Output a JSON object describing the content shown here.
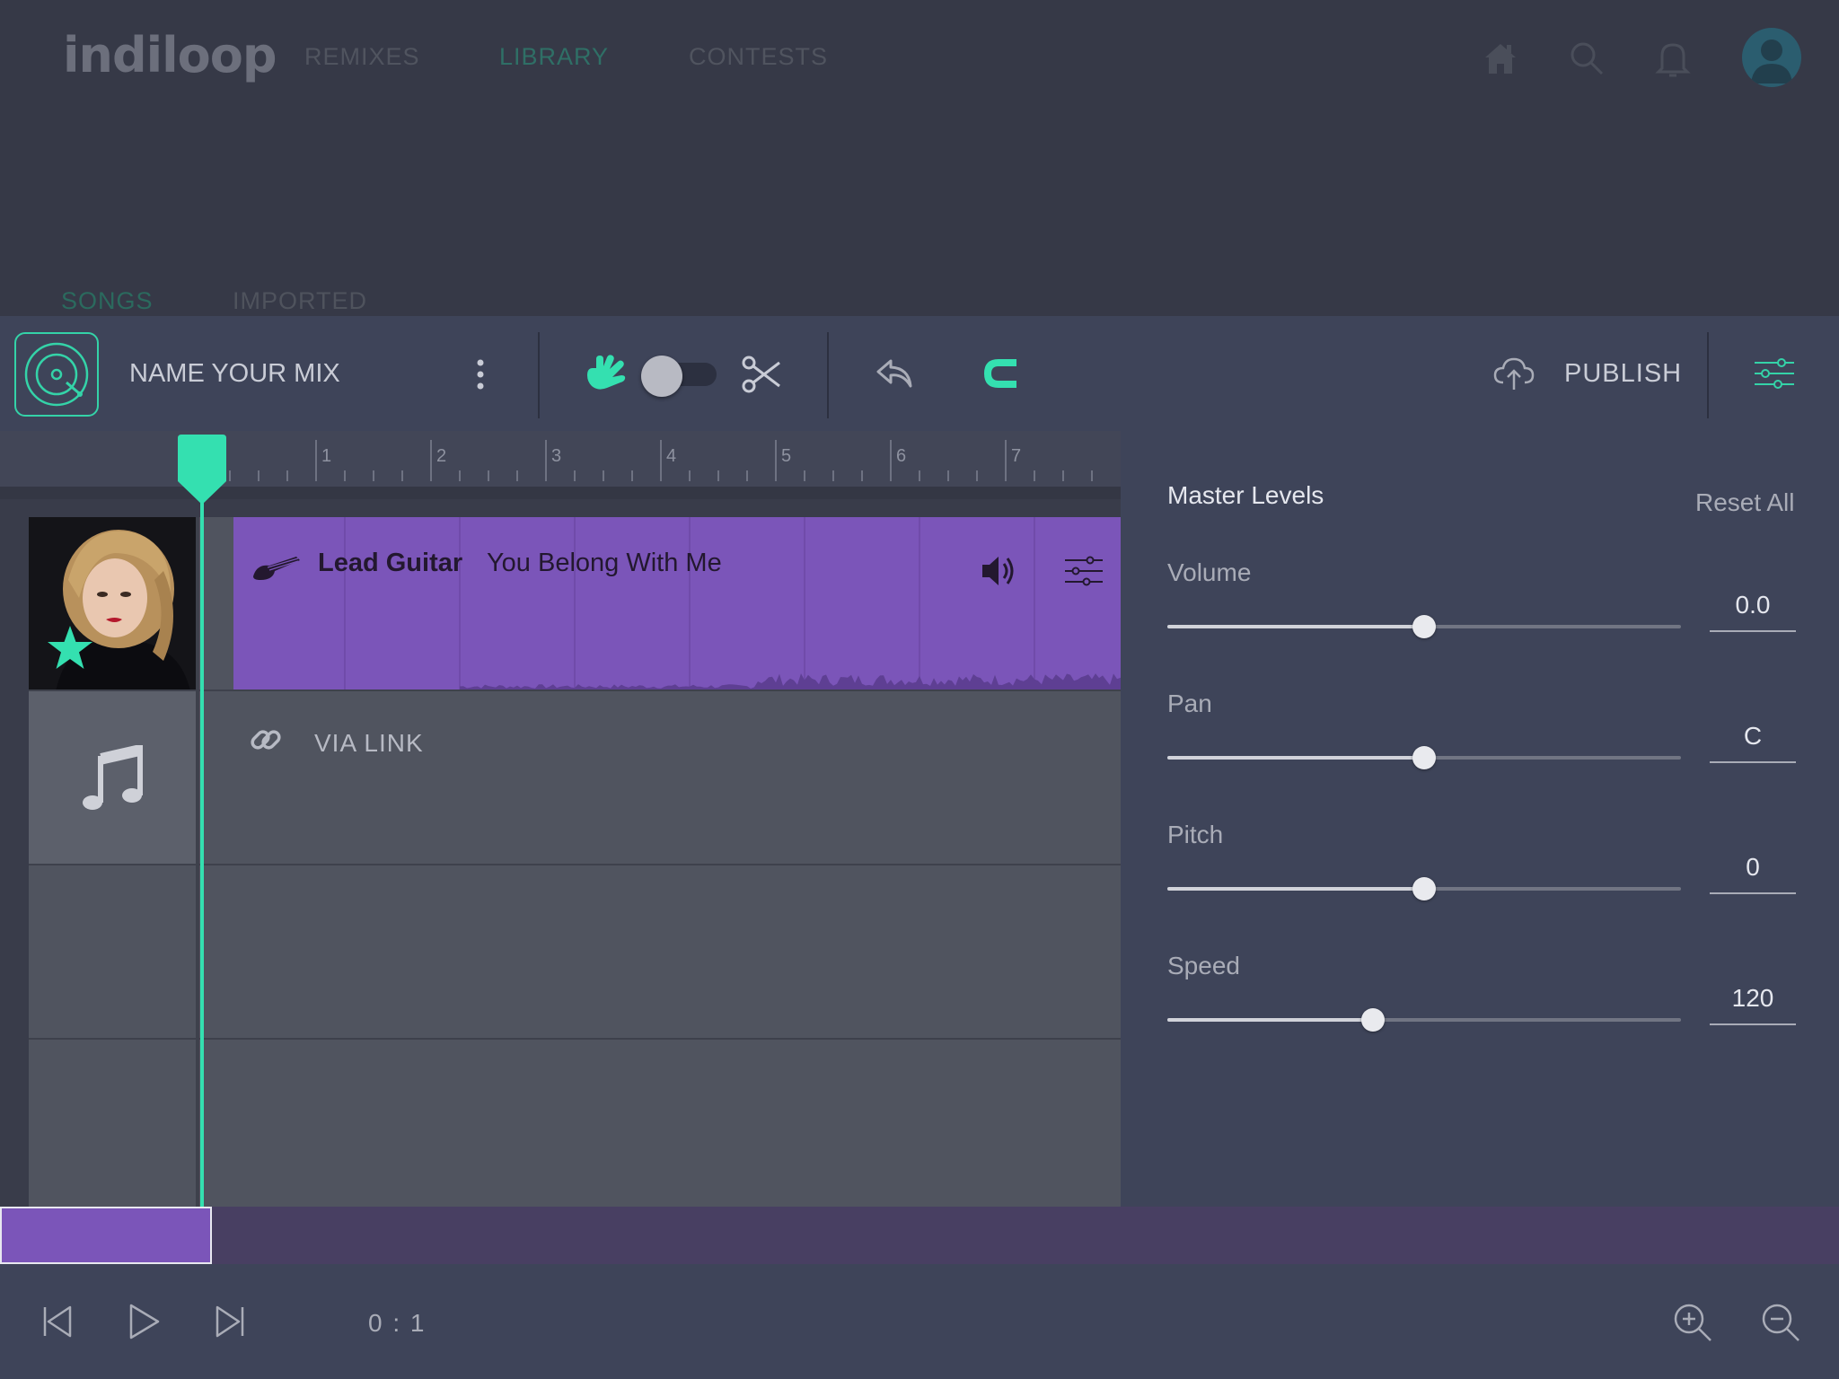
{
  "app": {
    "logo": "indiloop"
  },
  "nav": {
    "links": [
      "REMIXES",
      "LIBRARY",
      "CONTESTS"
    ],
    "active": "LIBRARY"
  },
  "subtabs": {
    "items": [
      "SONGS",
      "IMPORTED"
    ],
    "active": "SONGS"
  },
  "toolbar": {
    "mix_name": "NAME YOUR MIX",
    "publish_label": "PUBLISH",
    "mode_toggle": "off"
  },
  "ruler": {
    "marks": [
      "1",
      "2",
      "3",
      "4",
      "5",
      "6",
      "7"
    ]
  },
  "tracks": [
    {
      "instrument": "Lead Guitar",
      "song": "You Belong With Me"
    },
    {
      "label": "VIA LINK"
    }
  ],
  "master_levels": {
    "title": "Master Levels",
    "reset_label": "Reset All",
    "levels": [
      {
        "name": "Volume",
        "value": "0.0",
        "position": 0.5
      },
      {
        "name": "Pan",
        "value": "C",
        "position": 0.5
      },
      {
        "name": "Pitch",
        "value": "0",
        "position": 0.5
      },
      {
        "name": "Speed",
        "value": "120",
        "position": 0.4
      }
    ]
  },
  "transport": {
    "time": "0 : 1"
  },
  "colors": {
    "accent": "#34e0b0",
    "clip": "#7b55b9",
    "background": "#363947"
  }
}
